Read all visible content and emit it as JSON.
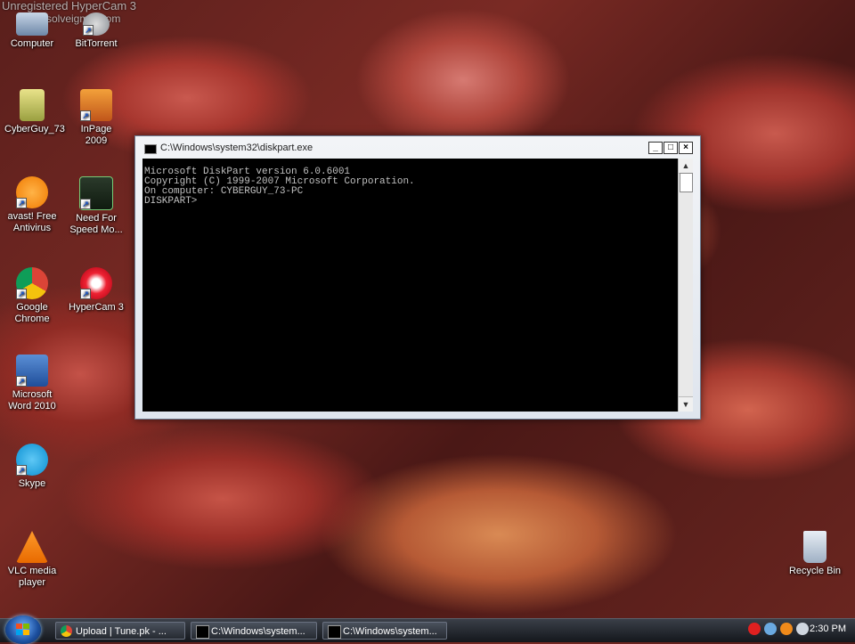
{
  "watermark": {
    "line1": "Unregistered HyperCam 3",
    "line2": "solveigmm.com"
  },
  "desktop_icons": [
    {
      "label": "Computer"
    },
    {
      "label": "BitTorrent"
    },
    {
      "label": "CyberGuy_73"
    },
    {
      "label": "InPage 2009"
    },
    {
      "label": "avast! Free Antivirus"
    },
    {
      "label": "Need For Speed Mo..."
    },
    {
      "label": "Google Chrome"
    },
    {
      "label": "HyperCam 3"
    },
    {
      "label": "Microsoft Word 2010"
    },
    {
      "label": "Skype"
    },
    {
      "label": "VLC media player"
    },
    {
      "label": "Recycle Bin"
    }
  ],
  "cmd_window": {
    "title": "C:\\Windows\\system32\\diskpart.exe",
    "lines": [
      "Microsoft DiskPart version 6.0.6001",
      "Copyright (C) 1999-2007 Microsoft Corporation.",
      "On computer: CYBERGUY_73-PC",
      "",
      "DISKPART> "
    ],
    "minimize": "_",
    "maximize": "□",
    "close": "×"
  },
  "taskbar": {
    "tasks": [
      {
        "label": "Upload | Tune.pk - ..."
      },
      {
        "label": "C:\\Windows\\system..."
      },
      {
        "label": "C:\\Windows\\system..."
      }
    ],
    "clock": "2:30 PM"
  }
}
